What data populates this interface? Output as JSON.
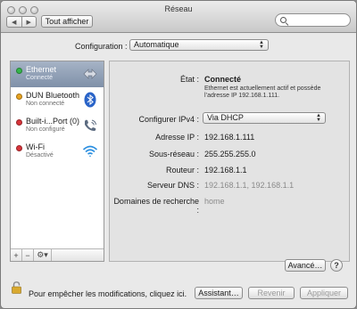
{
  "window": {
    "title": "Réseau"
  },
  "toolbar": {
    "show_all_label": "Tout afficher",
    "search_placeholder": ""
  },
  "configuration": {
    "label": "Configuration :",
    "value": "Automatique"
  },
  "sidebar": {
    "items": [
      {
        "name": "Ethernet",
        "status": "Connecté",
        "dot_color": "#35b64b",
        "icon": "ethernet-arrows-icon",
        "selected": true
      },
      {
        "name": "DUN Bluetooth",
        "status": "Non connecté",
        "dot_color": "#e8a321",
        "icon": "bluetooth-icon",
        "selected": false
      },
      {
        "name": "Built-i...Port (0)",
        "status": "Non configuré",
        "dot_color": "#d8343a",
        "icon": "phone-icon",
        "selected": false
      },
      {
        "name": "Wi-Fi",
        "status": "Désactivé",
        "dot_color": "#d8343a",
        "icon": "wifi-icon",
        "selected": false
      }
    ],
    "add_label": "+",
    "remove_label": "−",
    "gear_label": "⚙▾"
  },
  "details": {
    "state_label": "État :",
    "state_value": "Connecté",
    "state_desc_line1": "Ethernet est actuellement actif et possède",
    "state_desc_line2": "l’adresse IP 192.168.1.111.",
    "ipv4_label": "Configurer IPv4 :",
    "ipv4_value": "Via DHCP",
    "ip_label": "Adresse IP :",
    "ip_value": "192.168.1.111",
    "subnet_label": "Sous-réseau :",
    "subnet_value": "255.255.255.0",
    "router_label": "Routeur :",
    "router_value": "192.168.1.1",
    "dns_label": "Serveur DNS :",
    "dns_value": "192.168.1.1, 192.168.1.1",
    "search_domains_label": "Domaines de recherche :",
    "search_domains_value": "home",
    "advanced_label": "Avancé…",
    "help_label": "?"
  },
  "footer": {
    "lock_text": "Pour empêcher les modifications, cliquez ici.",
    "assistant_label": "Assistant…",
    "revert_label": "Revenir",
    "apply_label": "Appliquer"
  },
  "colors": {
    "selection": "#8fa0b8",
    "connected": "#35b64b",
    "warning": "#e8a321",
    "off": "#d8343a"
  }
}
